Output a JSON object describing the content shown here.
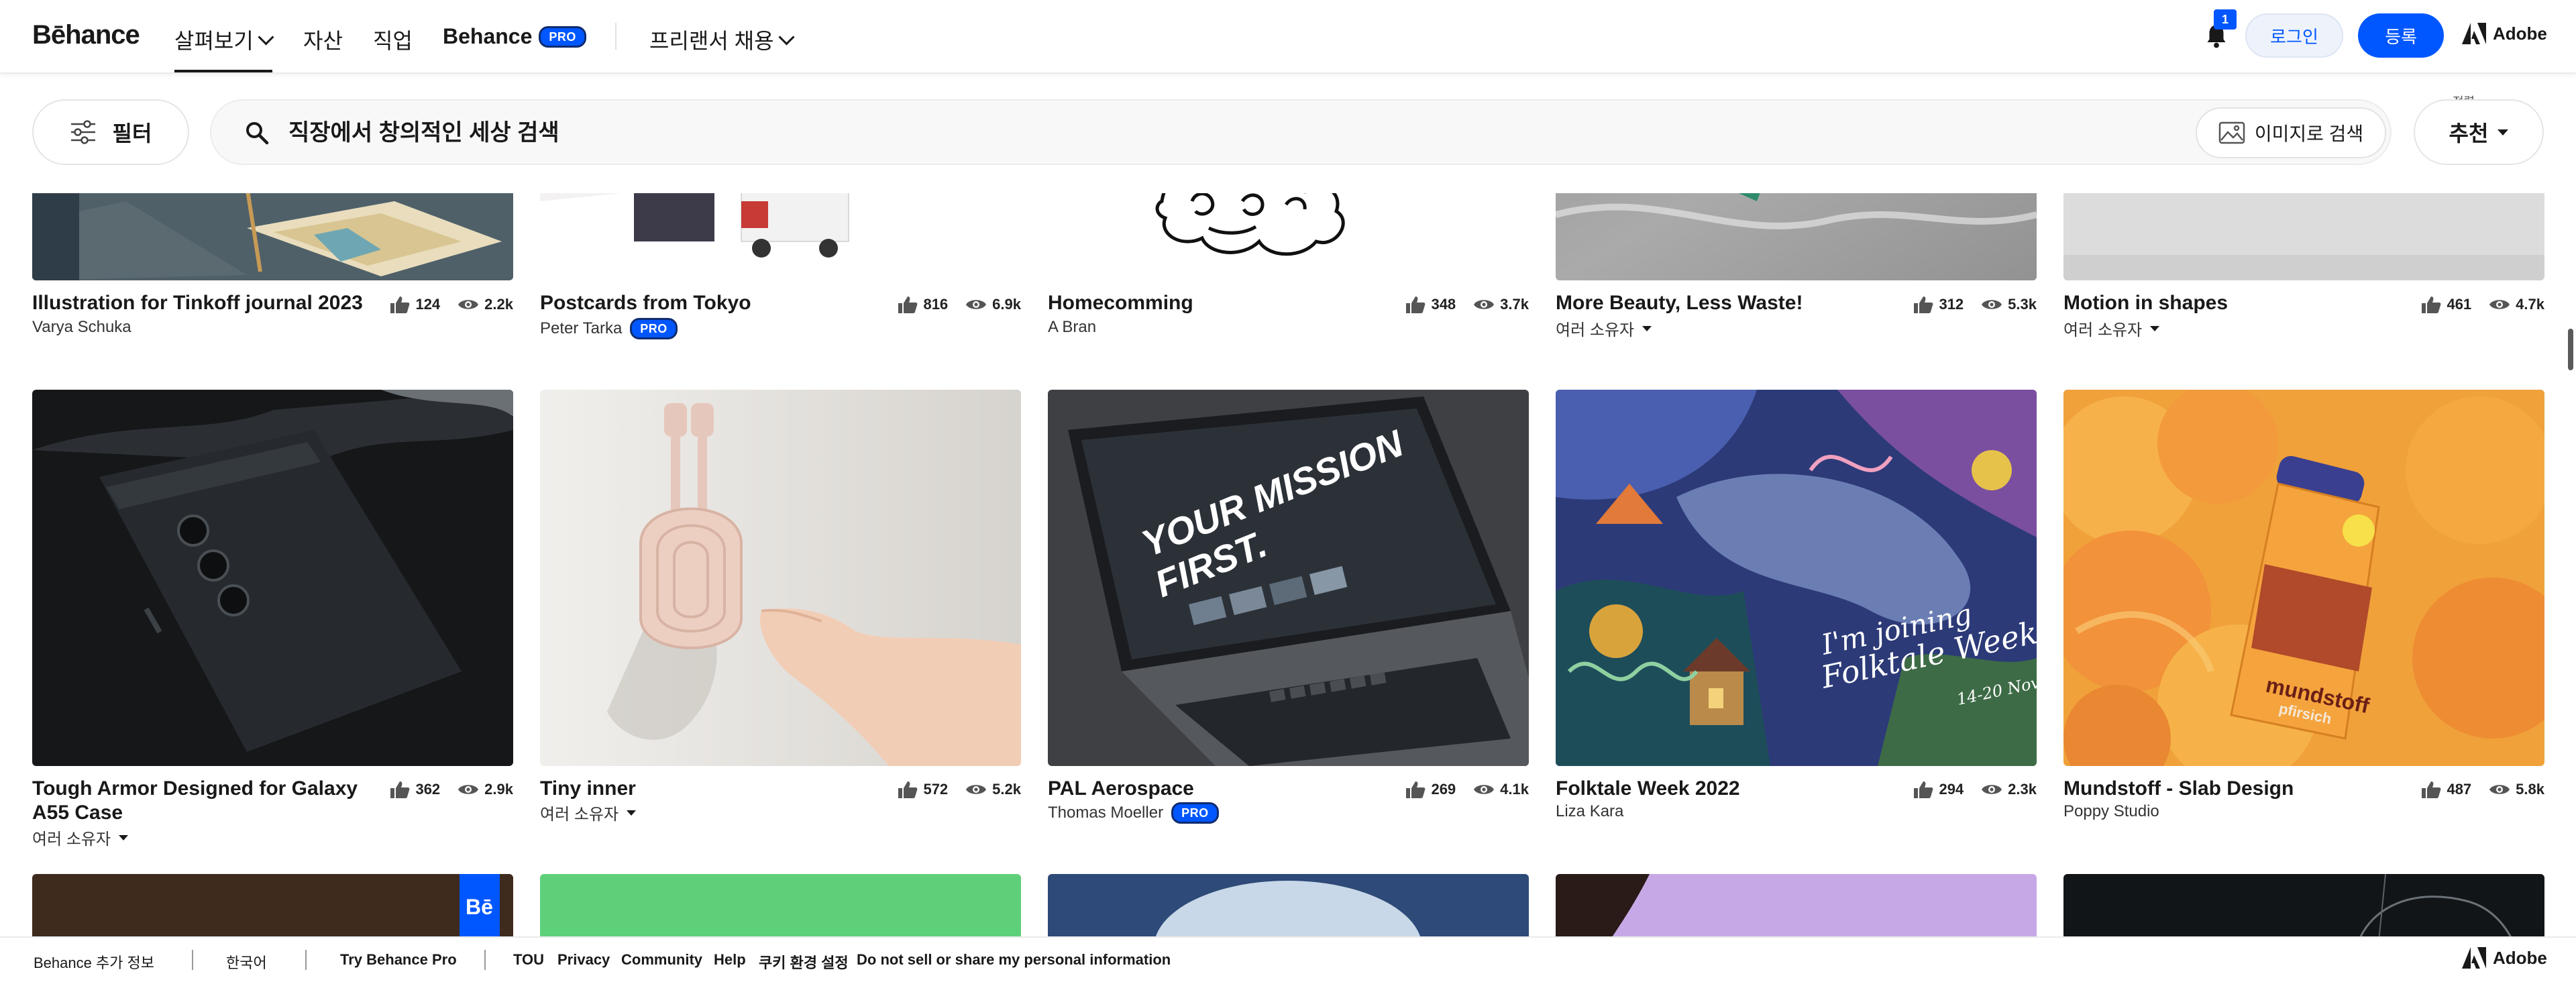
{
  "nav": {
    "logo": "Bēhance",
    "explore": "살펴보기",
    "assets": "자산",
    "jobs": "직업",
    "behance": "Behance",
    "pro": "PRO",
    "hire": "프리랜서 채용",
    "notif_count": "1",
    "login": "로그인",
    "signup": "등록",
    "adobe": "Adobe"
  },
  "search": {
    "filter": "필터",
    "placeholder": "직장에서 창의적인 세상 검색",
    "image_search": "이미지로 검색",
    "sort_label": "정렬",
    "sort_value": "추천"
  },
  "projects": [
    {
      "title": "Illustration for Tinkoff journal 2023",
      "owner": "Varya Schuka",
      "likes": "124",
      "views": "2.2k"
    },
    {
      "title": "Postcards from Tokyo",
      "owner": "Peter Tarka",
      "pro": "PRO",
      "likes": "816",
      "views": "6.9k"
    },
    {
      "title": "Homecomming",
      "owner": "A Bran",
      "likes": "348",
      "views": "3.7k"
    },
    {
      "title": "More Beauty, Less Waste!",
      "owner": "여러 소유자",
      "likes": "312",
      "views": "5.3k"
    },
    {
      "title": "Motion in shapes",
      "owner": "여러 소유자",
      "likes": "461",
      "views": "4.7k"
    },
    {
      "title": "Tough Armor Designed for Galaxy A55 Case",
      "owner": "여러 소유자",
      "likes": "362",
      "views": "2.9k"
    },
    {
      "title": "Tiny inner",
      "owner": "여러 소유자",
      "likes": "572",
      "views": "5.2k"
    },
    {
      "title": "PAL Aerospace",
      "owner": "Thomas Moeller",
      "pro": "PRO",
      "likes": "269",
      "views": "4.1k"
    },
    {
      "title": "Folktale Week 2022",
      "owner": "Liza Kara",
      "likes": "294",
      "views": "2.3k"
    },
    {
      "title": "Mundstoff - Slab Design",
      "owner": "Poppy Studio",
      "likes": "487",
      "views": "5.8k"
    }
  ],
  "thumb_text": {
    "laptop_line1": "YOUR MISSION",
    "laptop_line2": "FIRST.",
    "folktale_line1": "I'm joining",
    "folktale_line2": "Folktale Week",
    "folktale_line3": "14-20 Nov",
    "can_brand": "mundstoff",
    "can_flavor": "pfirsich",
    "be_badge": "Bē"
  },
  "footer": {
    "more": "Behance 추가 정보",
    "language": "한국어",
    "try_pro": "Try Behance Pro",
    "tou": "TOU",
    "privacy": "Privacy",
    "community": "Community",
    "help": "Help",
    "cookies": "쿠키 환경 설정",
    "dnsmpi": "Do not sell or share my personal information",
    "adobe": "Adobe"
  },
  "colors": {
    "accent": "#0057ff",
    "pro_border": "#0f2c70"
  }
}
